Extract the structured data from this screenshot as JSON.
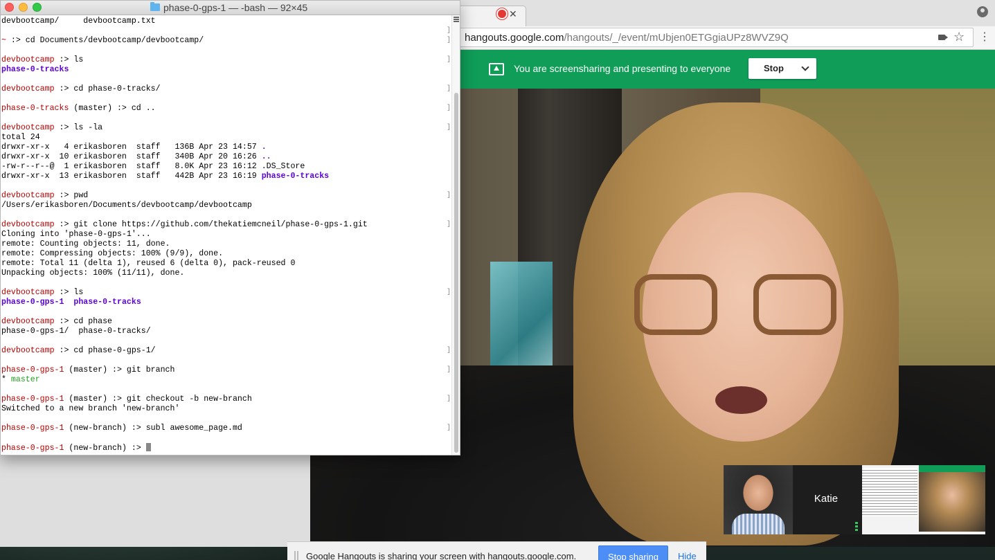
{
  "browser": {
    "url_host": "hangouts.google.com",
    "url_path": "/hangouts/_/event/mUbjen0ETGgiaUPz8WVZ9Q"
  },
  "hangouts": {
    "banner_text": "You are screensharing and presenting to everyone",
    "stop_label": "Stop",
    "participant_label": "Katie",
    "notice_text": "Google Hangouts is sharing your screen with hangouts.google.com.",
    "stop_sharing_label": "Stop sharing",
    "hide_label": "Hide",
    "banner_color": "#0f9d58"
  },
  "terminal": {
    "title": "phase-0-gps-1 — -bash — 92×45",
    "lines": [
      {
        "parts": [
          {
            "t": "devbootcamp/     devbootcamp.txt",
            "c": ""
          }
        ]
      },
      {
        "parts": [],
        "bracket": true
      },
      {
        "parts": [
          {
            "t": "~",
            "c": "prompt"
          },
          {
            "t": " :> cd Documents/devbootcamp/devbootcamp/",
            "c": ""
          }
        ],
        "bracket": true
      },
      {
        "parts": []
      },
      {
        "parts": [
          {
            "t": "devbootcamp",
            "c": "prompt"
          },
          {
            "t": " :> ls",
            "c": ""
          }
        ],
        "bracket": true
      },
      {
        "parts": [
          {
            "t": "phase-0-tracks",
            "c": "dir"
          }
        ]
      },
      {
        "parts": []
      },
      {
        "parts": [
          {
            "t": "devbootcamp",
            "c": "prompt"
          },
          {
            "t": " :> cd phase-0-tracks/",
            "c": ""
          }
        ],
        "bracket": true
      },
      {
        "parts": []
      },
      {
        "parts": [
          {
            "t": "phase-0-tracks",
            "c": "prompt"
          },
          {
            "t": " (master) :> cd ..",
            "c": ""
          }
        ],
        "bracket": true
      },
      {
        "parts": []
      },
      {
        "parts": [
          {
            "t": "devbootcamp",
            "c": "prompt"
          },
          {
            "t": " :> ls -la",
            "c": ""
          }
        ],
        "bracket": true
      },
      {
        "parts": [
          {
            "t": "total 24",
            "c": ""
          }
        ]
      },
      {
        "parts": [
          {
            "t": "drwxr-xr-x   4 erikasboren  staff   136B Apr 23 14:57 ",
            "c": ""
          },
          {
            "t": ".",
            "c": "dir"
          }
        ]
      },
      {
        "parts": [
          {
            "t": "drwxr-xr-x  10 erikasboren  staff   340B Apr 20 16:26 ",
            "c": ""
          },
          {
            "t": "..",
            "c": "dir"
          }
        ]
      },
      {
        "parts": [
          {
            "t": "-rw-r--r--@  1 erikasboren  staff   8.0K Apr 23 16:12 .DS_Store",
            "c": ""
          }
        ]
      },
      {
        "parts": [
          {
            "t": "drwxr-xr-x  13 erikasboren  staff   442B Apr 23 16:19 ",
            "c": ""
          },
          {
            "t": "phase-0-tracks",
            "c": "dir"
          }
        ]
      },
      {
        "parts": []
      },
      {
        "parts": [
          {
            "t": "devbootcamp",
            "c": "prompt"
          },
          {
            "t": " :> pwd",
            "c": ""
          }
        ],
        "bracket": true
      },
      {
        "parts": [
          {
            "t": "/Users/erikasboren/Documents/devbootcamp/devbootcamp",
            "c": ""
          }
        ]
      },
      {
        "parts": []
      },
      {
        "parts": [
          {
            "t": "devbootcamp",
            "c": "prompt"
          },
          {
            "t": " :> git clone https://github.com/thekatiemcneil/phase-0-gps-1.git",
            "c": ""
          }
        ],
        "bracket": true
      },
      {
        "parts": [
          {
            "t": "Cloning into 'phase-0-gps-1'...",
            "c": ""
          }
        ]
      },
      {
        "parts": [
          {
            "t": "remote: Counting objects: 11, done.",
            "c": ""
          }
        ]
      },
      {
        "parts": [
          {
            "t": "remote: Compressing objects: 100% (9/9), done.",
            "c": ""
          }
        ]
      },
      {
        "parts": [
          {
            "t": "remote: Total 11 (delta 1), reused 6 (delta 0), pack-reused 0",
            "c": ""
          }
        ]
      },
      {
        "parts": [
          {
            "t": "Unpacking objects: 100% (11/11), done.",
            "c": ""
          }
        ]
      },
      {
        "parts": []
      },
      {
        "parts": [
          {
            "t": "devbootcamp",
            "c": "prompt"
          },
          {
            "t": " :> ls",
            "c": ""
          }
        ],
        "bracket": true
      },
      {
        "parts": [
          {
            "t": "phase-0-gps-1",
            "c": "dir"
          },
          {
            "t": "  ",
            "c": ""
          },
          {
            "t": "phase-0-tracks",
            "c": "dir"
          }
        ]
      },
      {
        "parts": []
      },
      {
        "parts": [
          {
            "t": "devbootcamp",
            "c": "prompt"
          },
          {
            "t": " :> cd phase",
            "c": ""
          }
        ]
      },
      {
        "parts": [
          {
            "t": "phase-0-gps-1/  phase-0-tracks/",
            "c": ""
          }
        ]
      },
      {
        "parts": []
      },
      {
        "parts": [
          {
            "t": "devbootcamp",
            "c": "prompt"
          },
          {
            "t": " :> cd phase-0-gps-1/",
            "c": ""
          }
        ],
        "bracket": true
      },
      {
        "parts": []
      },
      {
        "parts": [
          {
            "t": "phase-0-gps-1",
            "c": "prompt"
          },
          {
            "t": " (master) :> git branch",
            "c": ""
          }
        ],
        "bracket": true
      },
      {
        "parts": [
          {
            "t": "* ",
            "c": ""
          },
          {
            "t": "master",
            "c": "green"
          }
        ]
      },
      {
        "parts": []
      },
      {
        "parts": [
          {
            "t": "phase-0-gps-1",
            "c": "prompt"
          },
          {
            "t": " (master) :> git checkout -b new-branch",
            "c": ""
          }
        ],
        "bracket": true
      },
      {
        "parts": [
          {
            "t": "Switched to a new branch 'new-branch'",
            "c": ""
          }
        ]
      },
      {
        "parts": []
      },
      {
        "parts": [
          {
            "t": "phase-0-gps-1",
            "c": "prompt"
          },
          {
            "t": " (new-branch) :> subl awesome_page.md",
            "c": ""
          }
        ],
        "bracket": true
      },
      {
        "parts": []
      },
      {
        "parts": [
          {
            "t": "phase-0-gps-1",
            "c": "prompt"
          },
          {
            "t": " (new-branch) :> ",
            "c": ""
          }
        ],
        "cursor": true
      }
    ]
  }
}
